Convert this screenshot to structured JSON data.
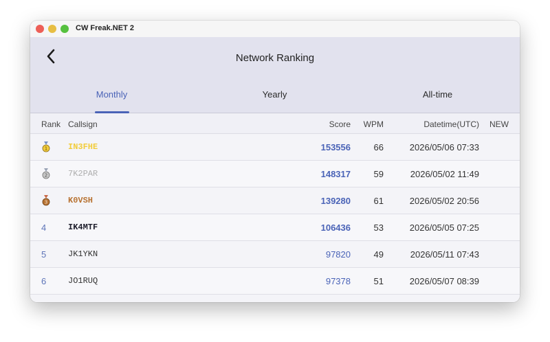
{
  "window": {
    "title": "CW Freak.NET 2",
    "traffic_lights": {
      "close": "#ed5f57",
      "minimize": "#e7be43",
      "maximize": "#56c13f"
    }
  },
  "nav": {
    "title": "Network Ranking",
    "back_icon": "chevron-left-icon"
  },
  "tabs": [
    {
      "label": "Monthly",
      "active": true
    },
    {
      "label": "Yearly",
      "active": false
    },
    {
      "label": "All-time",
      "active": false
    }
  ],
  "columns": {
    "rank": "Rank",
    "callsign": "Callsign",
    "score": "Score",
    "wpm": "WPM",
    "datetime": "Datetime(UTC)",
    "new": "NEW"
  },
  "colors": {
    "accent": "#4a63b7",
    "gold": "#f2cd3c",
    "silver": "#aeaeae",
    "bronze": "#b87333"
  },
  "rows": [
    {
      "rank": "1",
      "medal": "gold-medal-icon",
      "callsign": "IN3FHE",
      "score": "153556",
      "wpm": "66",
      "datetime": "2026/05/06 07:33"
    },
    {
      "rank": "2",
      "medal": "silver-medal-icon",
      "callsign": "7K2PAR",
      "score": "148317",
      "wpm": "59",
      "datetime": "2026/05/02 11:49"
    },
    {
      "rank": "3",
      "medal": "bronze-medal-icon",
      "callsign": "K0VSH",
      "score": "139280",
      "wpm": "61",
      "datetime": "2026/05/02 20:56"
    },
    {
      "rank": "4",
      "callsign": "IK4MTF",
      "score": "106436",
      "wpm": "53",
      "datetime": "2026/05/05 07:25"
    },
    {
      "rank": "5",
      "callsign": "JK1YKN",
      "score": "97820",
      "wpm": "49",
      "datetime": "2026/05/11 07:43"
    },
    {
      "rank": "6",
      "callsign": "JO1RUQ",
      "score": "97378",
      "wpm": "51",
      "datetime": "2026/05/07 08:39"
    }
  ]
}
